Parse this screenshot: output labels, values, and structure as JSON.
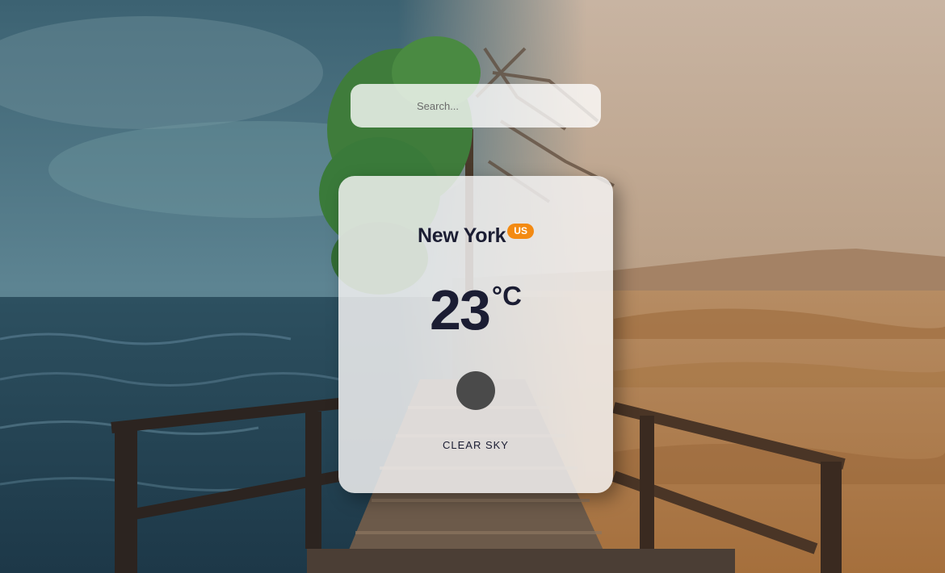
{
  "search": {
    "placeholder": "Search..."
  },
  "weather": {
    "city": "New York",
    "country": "US",
    "temperature": "23",
    "unit": "°C",
    "icon": "weather-icon-placeholder",
    "description": "CLEAR SKY"
  },
  "colors": {
    "badge": "#f38a12",
    "text": "#1b1d33",
    "icon": "#4a4a4a",
    "sea": "#2c4f63",
    "sand": "#b98a5c"
  }
}
